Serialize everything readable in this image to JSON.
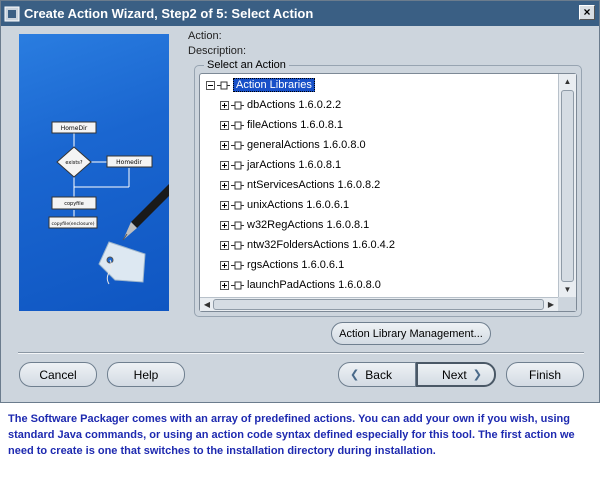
{
  "window": {
    "title": "Create Action Wizard, Step2 of 5: Select Action",
    "close_symbol": "×"
  },
  "form": {
    "action_label": "Action:",
    "description_label": "Description:",
    "group_title": "Select an Action"
  },
  "tree": {
    "root": "Action Libraries",
    "items": [
      {
        "label": "dbActions 1.6.0.2.2"
      },
      {
        "label": "fileActions 1.6.0.8.1"
      },
      {
        "label": "generalActions 1.6.0.8.0"
      },
      {
        "label": "jarActions 1.6.0.8.1"
      },
      {
        "label": "ntServicesActions 1.6.0.8.2"
      },
      {
        "label": "unixActions 1.6.0.6.1"
      },
      {
        "label": "w32RegActions 1.6.0.8.1"
      },
      {
        "label": "ntw32FoldersActions 1.6.0.4.2"
      },
      {
        "label": "rgsActions 1.6.0.6.1"
      },
      {
        "label": "launchPadActions 1.6.0.8.0"
      }
    ]
  },
  "art": {
    "box1": "HomeDir",
    "box2": "Homedir",
    "box3": "copyfile",
    "box4": "copyfile(enclosure)",
    "diamond": "exists?"
  },
  "buttons": {
    "library_management": "Action Library Management...",
    "cancel": "Cancel",
    "help": "Help",
    "back": "Back",
    "next": "Next",
    "finish": "Finish"
  },
  "caption": "The Software Packager comes with an array of predefined actions. You can add your own if you wish, using standard Java commands, or using an action code syntax defined especially for this tool. The first action we need to create is one that switches to the installation directory during installation.",
  "colors": {
    "titlebar": "#3a5f84",
    "dialog_bg": "#cdd5dd",
    "selection": "#1850c8",
    "caption_text": "#1e2ab0"
  },
  "icons": [
    "app-icon",
    "close-icon",
    "node-icon",
    "expander-icon",
    "chevron-left-icon",
    "chevron-right-icon"
  ]
}
